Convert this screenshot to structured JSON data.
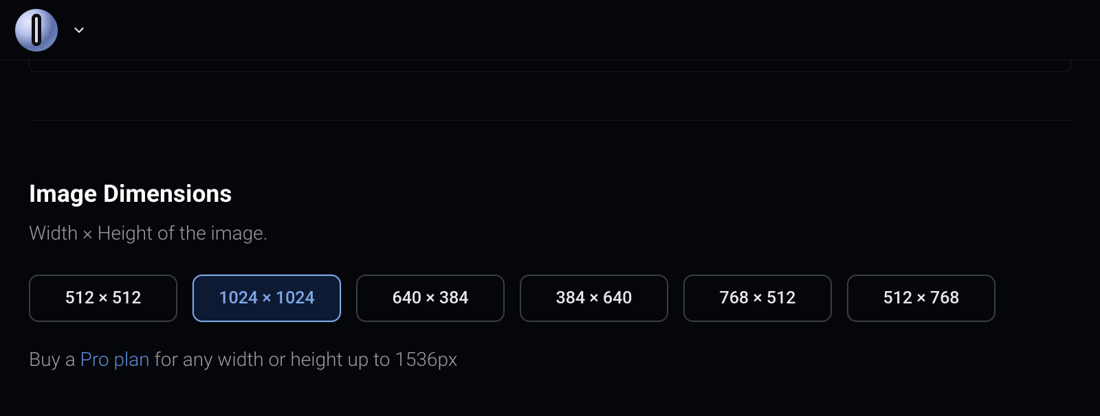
{
  "section": {
    "title": "Image Dimensions",
    "subtitle": "Width × Height of the image."
  },
  "dimensions": {
    "options": [
      {
        "label": "512 × 512",
        "selected": false
      },
      {
        "label": "1024 × 1024",
        "selected": true
      },
      {
        "label": "640 × 384",
        "selected": false
      },
      {
        "label": "384 × 640",
        "selected": false
      },
      {
        "label": "768 × 512",
        "selected": false
      },
      {
        "label": "512 × 768",
        "selected": false
      }
    ]
  },
  "upsell": {
    "prefix": "Buy a ",
    "link_text": "Pro plan",
    "suffix": " for any width or height up to 1536px"
  }
}
